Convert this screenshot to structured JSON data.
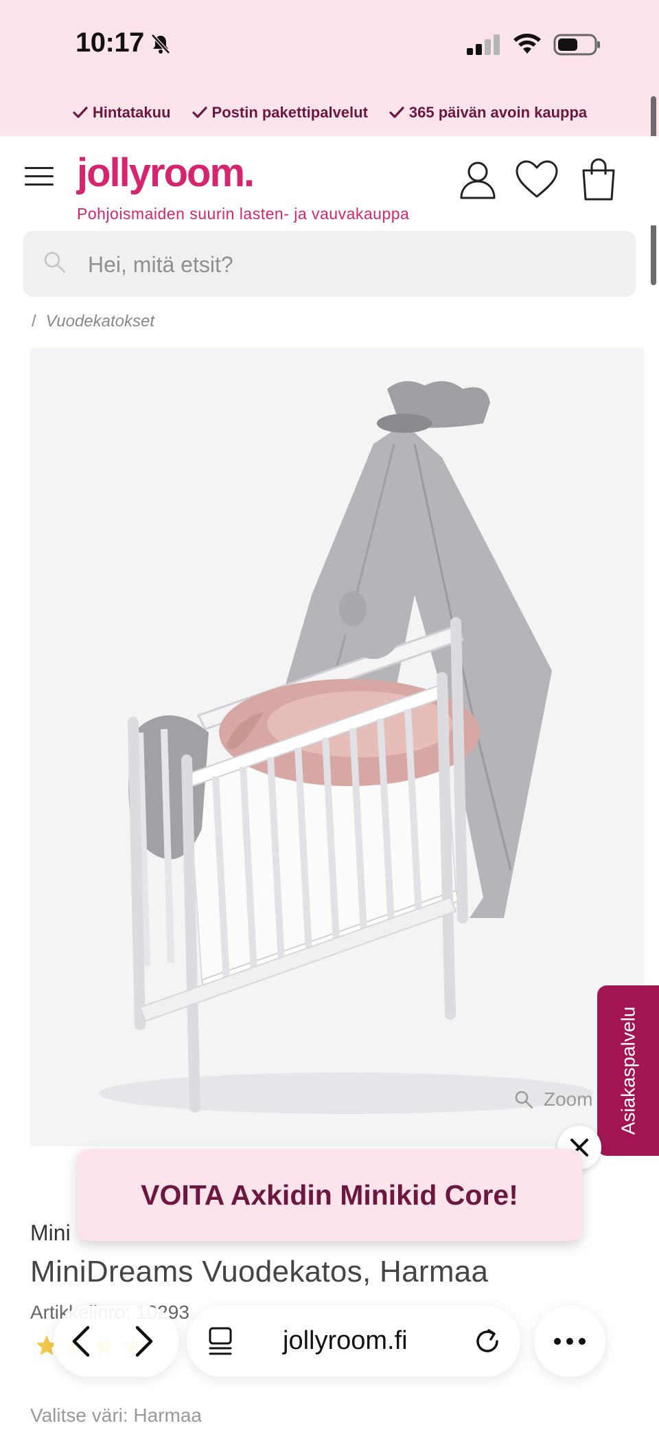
{
  "status_bar": {
    "time": "10:17",
    "icons": [
      "bell-muted-icon",
      "signal-icon",
      "wifi-icon",
      "battery-icon"
    ]
  },
  "usp_bar": {
    "items": [
      "Hintatakuu",
      "Postin pakettipalvelut",
      "365 päivän avoin kauppa"
    ]
  },
  "header": {
    "logo": "jollyroom.",
    "tagline": "Pohjoismaiden suurin lasten- ja vauvakauppa",
    "icons": [
      "menu-icon",
      "user-icon",
      "heart-icon",
      "shopping-bag-icon"
    ]
  },
  "search": {
    "placeholder": "Hei, mitä etsit?"
  },
  "breadcrumb": {
    "separator": "/",
    "current": "Vuodekatokset"
  },
  "product_image": {
    "zoom_label": "Zoom"
  },
  "side_tab": {
    "label": "Asiakaspalvelu"
  },
  "promo": {
    "text": "VOITA Axkidin Minikid Core!"
  },
  "product": {
    "brand": "Mini",
    "title": "MiniDreams Vuodekatos, Harmaa",
    "article_prefix": "Artikkelinro: 10293",
    "variant_label": "Valitse väri: Harmaa"
  },
  "browser": {
    "url": "jollyroom.fi",
    "icons": [
      "back-icon",
      "forward-icon",
      "tabs-icon",
      "reload-icon",
      "more-icon"
    ]
  },
  "colors": {
    "brand": "#d6246e",
    "usp_background": "#fce4ea",
    "usp_text": "#6b1740",
    "side_tab": "#a31452"
  }
}
